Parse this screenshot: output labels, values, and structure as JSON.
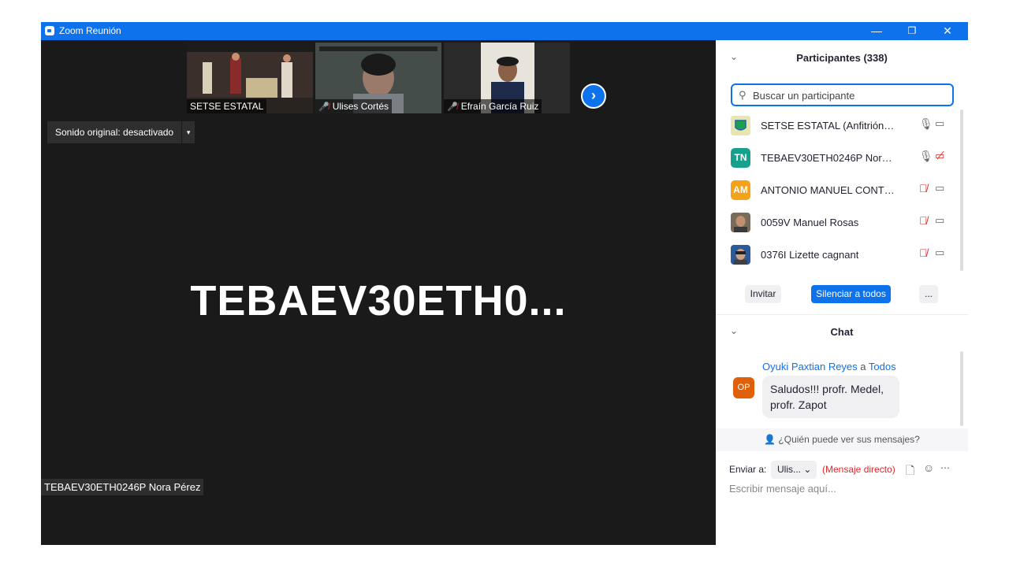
{
  "window": {
    "title": "Zoom Reunión",
    "minimize": "—",
    "restore": "❐",
    "close": "✕"
  },
  "thumbnails": [
    {
      "name": "SETSE ESTATAL",
      "muted": false
    },
    {
      "name": "Ulises Cortés",
      "muted": true
    },
    {
      "name": "Efraín García Ruiz",
      "muted": true
    }
  ],
  "next_label": "›",
  "sound": {
    "label": "Sonido original: desactivado",
    "arrow": "▾"
  },
  "main_speaker_big": "TEBAEV30ETH0...",
  "main_speaker_label": "TEBAEV30ETH0246P Nora Pérez",
  "participants": {
    "title": "Participantes (338)",
    "chevron": "⌄",
    "search_placeholder": "Buscar un participante",
    "search_icon": "⚲",
    "list": [
      {
        "initials": "",
        "name": "SETSE ESTATAL (Anfitrión, yo)",
        "color": "#c9c48a",
        "mic": "on",
        "cam": "on"
      },
      {
        "initials": "TN",
        "name": "TEBAEV30ETH0246P Nora Pérez",
        "color": "#17a08c",
        "mic": "on",
        "cam": "off"
      },
      {
        "initials": "AM",
        "name": " ANTONIO MANUEL CONTRER...",
        "color": "#f4a21a",
        "mic": "muted",
        "cam": "on"
      },
      {
        "initials": "",
        "name": "0059V Manuel Rosas",
        "color": "#6b5a4a",
        "mic": "muted",
        "cam": "on"
      },
      {
        "initials": "",
        "name": "0376I Lizette cagnant",
        "color": "#3a6ea8",
        "mic": "muted",
        "cam": "on"
      }
    ],
    "invite": "Invitar",
    "mute_all": "Silenciar a todos",
    "more": "..."
  },
  "chat": {
    "title": "Chat",
    "sender": "Oyuki Paxtian Reyes",
    "to_word": "a",
    "recipient": "Todos",
    "avatar": "OP",
    "message": "Saludos!!! profr. Medel, profr. Zapot",
    "who_can_see": "¿Quién puede ver sus mensajes?",
    "send_to_label": "Enviar a:",
    "send_to_value": "Ulis...",
    "direct": "(Mensaje directo)",
    "compose_placeholder": "Escribir mensaje aquí..."
  }
}
